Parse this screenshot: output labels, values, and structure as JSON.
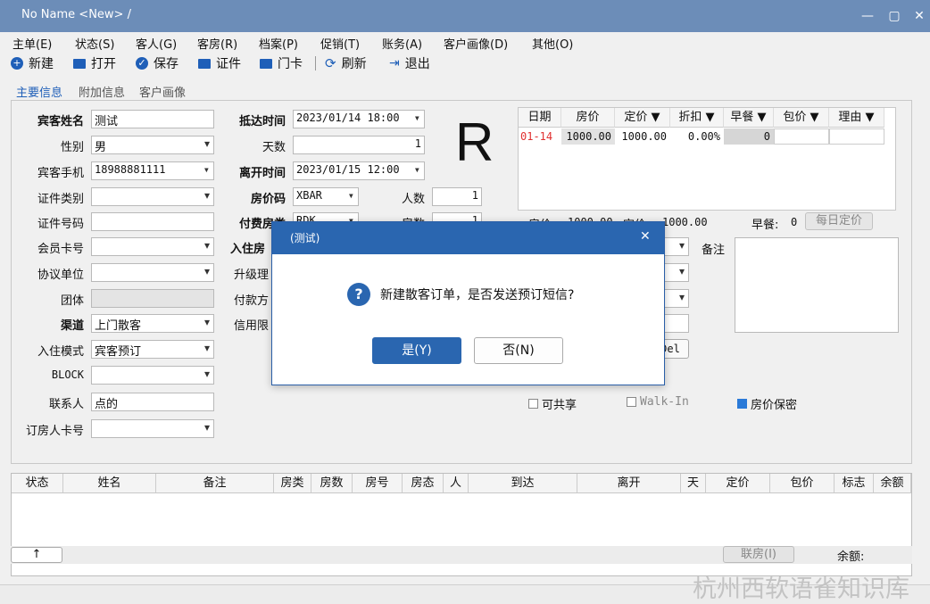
{
  "window": {
    "title": "No Name <New> /",
    "min": "—",
    "max": "▢",
    "close": "✕"
  },
  "menu": [
    "主单(E)",
    "状态(S)",
    "客人(G)",
    "客房(R)",
    "档案(P)",
    "促销(T)",
    "账务(A)",
    "客户画像(D)",
    "其他(O)"
  ],
  "toolbar": {
    "new": "新建",
    "open": "打开",
    "save": "保存",
    "cert": "证件",
    "card": "门卡",
    "refresh": "刷新",
    "exit": "退出"
  },
  "tabs": [
    "主要信息",
    "附加信息",
    "客户画像"
  ],
  "left": {
    "guest_name_label": "宾客姓名",
    "guest_name": "测试",
    "gender_label": "性别",
    "gender": "男",
    "phone_label": "宾客手机",
    "phone": "18988881111",
    "id_type_label": "证件类别",
    "id_no_label": "证件号码",
    "member_label": "会员卡号",
    "agreement_label": "协议单位",
    "group_label": "团体",
    "channel_label": "渠道",
    "channel": "上门散客",
    "checkin_mode_label": "入住模式",
    "checkin_mode": "宾客预订",
    "block_label": "BLOCK",
    "contact_label": "联系人",
    "contact": "点的",
    "booker_card_label": "订房人卡号"
  },
  "mid": {
    "arrival_label": "抵达时间",
    "arrival": "2023/01/14 18:00",
    "days_label": "天数",
    "days": "1",
    "depart_label": "离开时间",
    "depart": "2023/01/15 12:00",
    "rate_code_label": "房价码",
    "rate_code": "XBAR",
    "persons_label": "人数",
    "persons": "1",
    "paid_room_label": "付费房类",
    "paid_room": "RDK",
    "rooms_label": "房数",
    "rooms": "1",
    "checkin_room_label": "入住房",
    "upgrade_label": "升级理",
    "pay_label": "付款方",
    "credit_label": "信用限",
    "room_status_letter": "R"
  },
  "rate_table": {
    "headers": [
      "日期",
      "房价",
      "定价 ▼",
      "折扣 ▼",
      "早餐 ▼",
      "包价 ▼",
      "理由 ▼"
    ],
    "row": [
      "01-14",
      "1000.00",
      "1000.00",
      "0.00%",
      "0",
      "",
      ""
    ]
  },
  "summary": {
    "room_rate_label": "房价",
    "room_rate": "1000.00",
    "price_label": "定价",
    "price": "1000.00",
    "breakfast_label": "早餐:",
    "breakfast": "0",
    "daily_price_button": "每日定价"
  },
  "right": {
    "remark_label": "备注",
    "del_button": "Del"
  },
  "checks": {
    "shareable": "可共享",
    "walkin": "Walk-In",
    "rate_secret": "房价保密"
  },
  "grid": {
    "headers": [
      "状态",
      "姓名",
      "备注",
      "房类",
      "房数",
      "房号",
      "房态",
      "人",
      "到达",
      "离开",
      "天",
      "定价",
      "包价",
      "标志",
      "余额"
    ],
    "up_arrow": "↑",
    "link_room_button": "联房(I)",
    "balance_label": "余额:"
  },
  "dialog": {
    "title": "(测试)",
    "close": "✕",
    "icon": "?",
    "message": "新建散客订单，是否发送预订短信?",
    "yes": "是(Y)",
    "no": "否(N)"
  },
  "watermark": "杭州西软语雀知识库",
  "colors": {
    "accent": "#2a66b0",
    "title_bar": "#6c8db8",
    "date_red": "#e03030"
  }
}
